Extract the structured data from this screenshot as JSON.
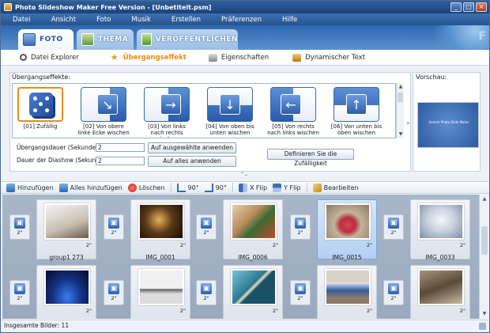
{
  "window": {
    "title": "Photo Slideshow Maker Free Version - [Unbetitelt.psm]",
    "controls": [
      "_",
      "□",
      "×"
    ]
  },
  "menu": [
    "Datei",
    "Ansicht",
    "Foto",
    "Musik",
    "Erstellen",
    "Präferenzen",
    "Hilfe"
  ],
  "main_tabs": [
    "FOTO",
    "THEMA",
    "VERÖFFENTLICHEN"
  ],
  "main_tab_decoration": "F",
  "sub_tabs": [
    "Datei Explorer",
    "Übergangseffekt",
    "Eigenschaften",
    "Dynamischer Text"
  ],
  "effects": {
    "label": "Übergangseffekte:",
    "items": [
      {
        "label": "[01] Zufällig",
        "icon": "dice-icon"
      },
      {
        "label": "[02] Von obere linke Ecke wischen",
        "icon": "arrow-diagonal-icon",
        "glyph": "↘"
      },
      {
        "label": "[03] Von links nach rechts wischen",
        "icon": "arrow-right-icon",
        "glyph": "→"
      },
      {
        "label": "[04] Von oben bis unten wischen",
        "icon": "arrow-down-icon",
        "glyph": "↓"
      },
      {
        "label": "[05] Von rechts nach links wischen",
        "icon": "arrow-left-icon",
        "glyph": "←"
      },
      {
        "label": "[06] Von unten bis oben wischen",
        "icon": "arrow-up-icon",
        "glyph": "↑"
      }
    ],
    "transition_duration_label": "Übergangsdauer (Sekunden):",
    "transition_duration_value": "2",
    "slide_duration_label": "Dauer der Diashow (Sekunden):",
    "slide_duration_value": "2",
    "apply_selected_button": "Auf ausgewählte anwenden",
    "apply_all_button": "Auf alles anwenden",
    "define_random_button": "Definieren Sie die Zufälligkeit"
  },
  "preview": {
    "label": "Vorschau:",
    "caption": "Amenir Photo Slide Maker"
  },
  "toolbar": {
    "add": "Hinzufügen",
    "add_all": "Alles hinzufügen",
    "delete": "Löschen",
    "rotate_left": "90°",
    "rotate_right": "90°",
    "xflip": "X Flip",
    "yflip": "Y Flip",
    "edit": "Bearbeiten"
  },
  "storyboard": {
    "slot_duration": "2\"",
    "row1": [
      {
        "name": "group1 273",
        "duration": "2\"",
        "selected": false,
        "colors": [
          "#f4f4f4",
          "#9a8470"
        ]
      },
      {
        "name": "IMG_0001",
        "duration": "2\"",
        "selected": false,
        "colors": [
          "#1d1208",
          "#c28a3a"
        ]
      },
      {
        "name": "IMG_0006",
        "duration": "2\"",
        "selected": false,
        "colors": [
          "#d8c8a8",
          "#7a5230"
        ]
      },
      {
        "name": "IMG_0015",
        "duration": "2\"",
        "selected": true,
        "colors": [
          "#c7b7a1",
          "#c83a3c"
        ]
      },
      {
        "name": "IMG_0033",
        "duration": "2\"",
        "selected": false,
        "colors": [
          "#e4e8ee",
          "#8a9ab0"
        ]
      }
    ],
    "row2": [
      {
        "duration": "2\"",
        "colors": [
          "#0d1f6a",
          "#2e6ae0"
        ]
      },
      {
        "duration": "2\"",
        "colors": [
          "#e9e9e9",
          "#3a3a3a"
        ]
      },
      {
        "duration": "2\"",
        "colors": [
          "#3c8fa8",
          "#0f4558"
        ]
      },
      {
        "duration": "2\"",
        "colors": [
          "#c8c0b4",
          "#2e5aa0"
        ]
      },
      {
        "duration": "2\"",
        "colors": [
          "#6b5a4a",
          "#c9bba4"
        ]
      }
    ]
  },
  "status": {
    "total_images": "Insgesamte Bilder: 11"
  },
  "colors": {
    "title_bar": "#2f5f9c",
    "accent_orange": "#f08a12",
    "selected_card": "#b4d0f3"
  }
}
